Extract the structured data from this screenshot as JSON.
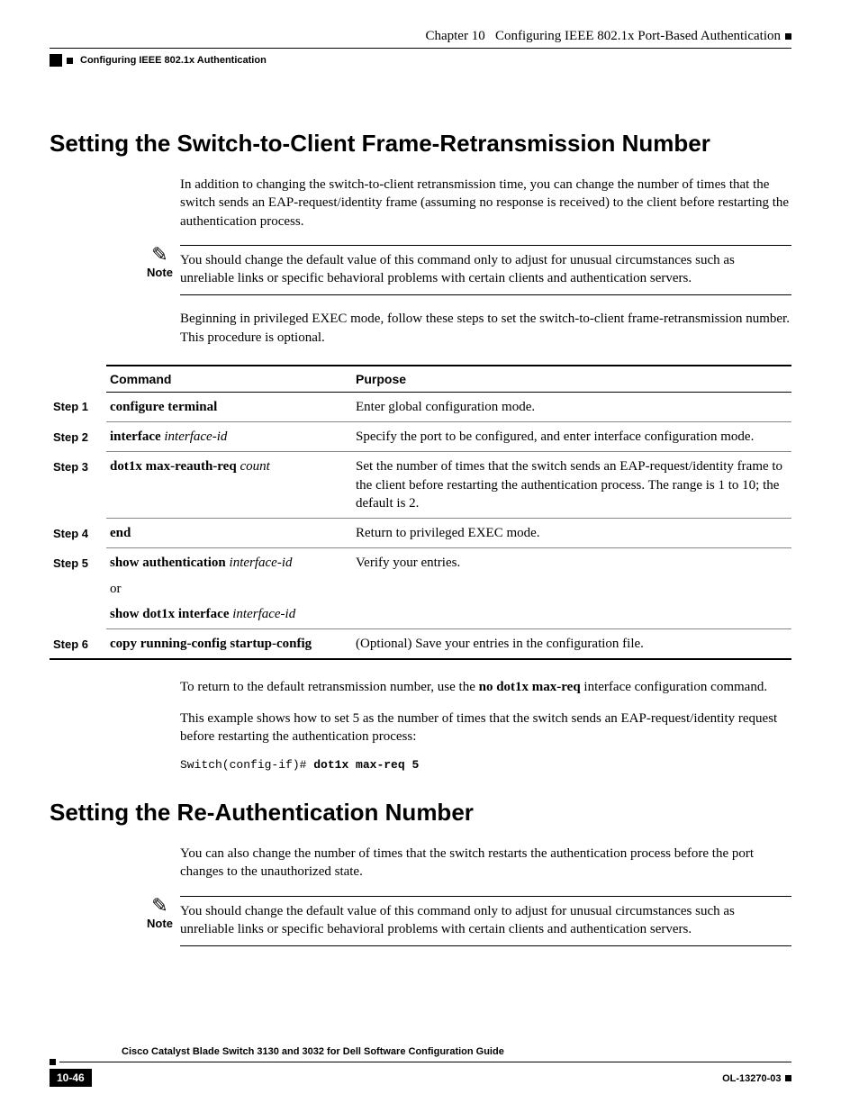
{
  "header": {
    "chapter_label": "Chapter 10",
    "chapter_title": "Configuring IEEE 802.1x Port-Based Authentication",
    "section_title": "Configuring IEEE 802.1x Authentication"
  },
  "section1": {
    "heading": "Setting the Switch-to-Client Frame-Retransmission Number",
    "intro": "In addition to changing the switch-to-client retransmission time, you can change the number of times that the switch sends an EAP-request/identity frame (assuming no response is received) to the client before restarting the authentication process.",
    "note_label": "Note",
    "note_text": "You should change the default value of this command only to adjust for unusual circumstances such as unreliable links or specific behavioral problems with certain clients and authentication servers.",
    "procedure_intro": "Beginning in privileged EXEC mode, follow these steps to set the switch-to-client frame-retransmission number. This procedure is optional.",
    "table": {
      "header": {
        "col1": "Command",
        "col2": "Purpose"
      },
      "rows": [
        {
          "step": "Step 1",
          "command_bold": "configure terminal",
          "command_ital": "",
          "purpose": "Enter global configuration mode."
        },
        {
          "step": "Step 2",
          "command_bold": "interface",
          "command_ital": "interface-id",
          "purpose": "Specify the port to be configured, and enter interface configuration mode."
        },
        {
          "step": "Step 3",
          "command_bold": "dot1x max-reauth-req",
          "command_ital": "count",
          "purpose": "Set the number of times that the switch sends an EAP-request/identity frame to the client before restarting the authentication process. The range is 1 to 10; the default is 2."
        },
        {
          "step": "Step 4",
          "command_bold": "end",
          "command_ital": "",
          "purpose": "Return to privileged EXEC mode."
        },
        {
          "step": "Step 5",
          "command_bold": "show authentication",
          "command_ital": "interface-id",
          "command_or": "or",
          "command_bold2": "show dot1x interface",
          "command_ital2": "interface-id",
          "purpose": "Verify your entries."
        },
        {
          "step": "Step 6",
          "command_bold": "copy running-config startup-config",
          "command_ital": "",
          "purpose": "(Optional) Save your entries in the configuration file."
        }
      ]
    },
    "return_default_pre": "To return to the default retransmission number, use the ",
    "return_default_bold": "no dot1x max-req",
    "return_default_post": " interface configuration command.",
    "example_text": "This example shows how to set 5 as the number of times that the switch sends an EAP-request/identity request before restarting the authentication process:",
    "code_prompt": "Switch(config-if)# ",
    "code_cmd": "dot1x max-req 5"
  },
  "section2": {
    "heading": "Setting the Re-Authentication Number",
    "intro": "You can also change the number of times that the switch restarts the authentication process before the port changes to the unauthorized state.",
    "note_label": "Note",
    "note_text": "You should change the default value of this command only to adjust for unusual circumstances such as unreliable links or specific behavioral problems with certain clients and authentication servers."
  },
  "footer": {
    "guide_title": "Cisco Catalyst Blade Switch 3130 and 3032 for Dell Software Configuration Guide",
    "page_number": "10-46",
    "doc_number": "OL-13270-03"
  }
}
